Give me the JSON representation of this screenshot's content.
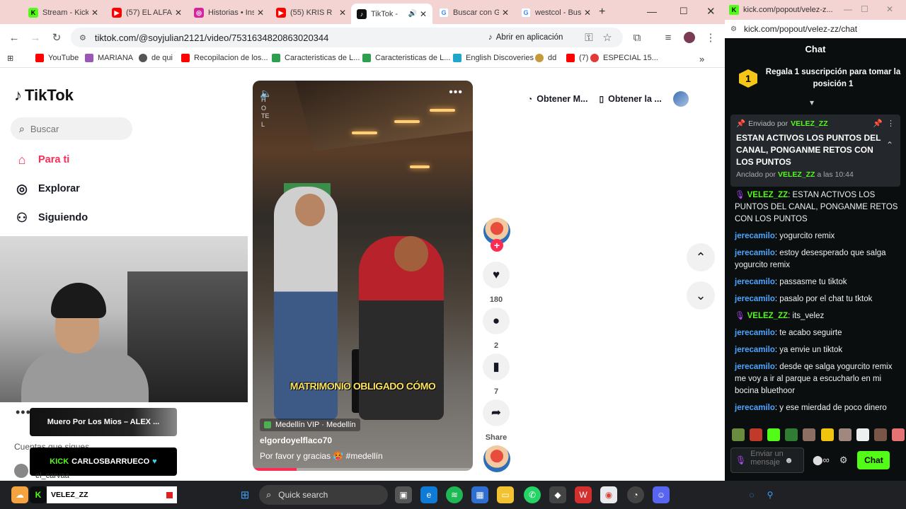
{
  "browser": {
    "tabs": [
      {
        "title": "Stream - Kick",
        "fav": "K",
        "fav_color": "#53fc18"
      },
      {
        "title": "(57) EL ALFA",
        "fav": "▶",
        "fav_color": "#ff0000"
      },
      {
        "title": "Historias • Instagram",
        "fav": "◎",
        "fav_color": "#d6249f"
      },
      {
        "title": "(55) KRIS R",
        "fav": "▶",
        "fav_color": "#ff0000"
      },
      {
        "title": "TikTok - ",
        "fav": "♪",
        "fav_color": "#111111"
      },
      {
        "title": "Buscar con Google",
        "fav": "G",
        "fav_color": "#4285f4"
      },
      {
        "title": "westcol - Buscar",
        "fav": "G",
        "fav_color": "#4285f4"
      }
    ],
    "url": "tiktok.com/@soyjulian2121/video/7531634820863020344",
    "open_in_app": "Abrir en aplicación",
    "bookmarks": [
      {
        "label": "YouTube",
        "color": "#ff0000"
      },
      {
        "label": "MARIANA",
        "color": "#9b59b6"
      },
      {
        "label": "de qui",
        "color": "#555555"
      },
      {
        "label": "Recopilacion de los...",
        "color": "#ff0000"
      },
      {
        "label": "Caracteristicas de L...",
        "color": "#2e9e4f"
      },
      {
        "label": "Caracteristicas de L...",
        "color": "#2e9e4f"
      },
      {
        "label": "English Discoveries",
        "color": "#1fa6c9"
      },
      {
        "label": "dd",
        "color": "#c49a3a"
      },
      {
        "label": "(7)",
        "color": "#ff0000"
      },
      {
        "label": "ESPECIAL 15...",
        "color": "#e03a3a"
      }
    ]
  },
  "tiktok": {
    "logo": "TikTok",
    "search_placeholder": "Buscar",
    "nav": [
      {
        "label": "Para ti",
        "icon": "home-icon"
      },
      {
        "label": "Explorar",
        "icon": "compass-icon"
      },
      {
        "label": "Siguiendo",
        "icon": "following-icon"
      }
    ],
    "top_right": {
      "get_app": "Obtener M...",
      "get_desktop": "Obtener la ..."
    },
    "following_label": "Cuentas que sigues",
    "follow_user": "el_carvaa",
    "video": {
      "caption_overlay": "MATRIMONIO OBLIGADO CÓMO",
      "location": "Medellín VIP · Medellín",
      "author": "elgordoyelflaco70",
      "description": "Por favor y gracias 🥵 #medellín",
      "progress": 0.2,
      "sign_text": "HOTEL"
    },
    "actions": [
      {
        "name": "like",
        "icon": "♥",
        "count": "180"
      },
      {
        "name": "comment",
        "icon": "●",
        "count": "2"
      },
      {
        "name": "save",
        "icon": "▮",
        "count": "7"
      },
      {
        "name": "share",
        "icon": "➦",
        "count": "Share"
      }
    ]
  },
  "overlays": {
    "song": "Muero Por Los Mios – ALEX ...",
    "sub_alert": "CARLOSBARRUECO",
    "sub_prefix": "KICK"
  },
  "kick": {
    "popup_tab": "kick.com/popout/velez-z...",
    "popup_url": "kick.com/popout/velez-zz/chat",
    "header": "Chat",
    "gift_rank": "1",
    "gift_text": "Regala 1 suscripción para tomar la posición 1",
    "pinned": {
      "sent_by": "Enviado por",
      "user": "VELEZ_ZZ",
      "message": "ESTAN ACTIVOS LOS PUNTOS DEL CANAL, PONGANME RETOS CON LOS PUNTOS",
      "pinned_by": "Anclado por",
      "pinned_at": "a las 10:44"
    },
    "messages": [
      {
        "user": "VELEZ_ZZ",
        "color": "green",
        "mic": true,
        "text": ": ESTAN ACTIVOS LOS PUNTOS DEL CANAL, PONGANME RETOS CON LOS PUNTOS"
      },
      {
        "user": "jerecamilo",
        "color": "blue",
        "mic": false,
        "text": ": yogurcito remix"
      },
      {
        "user": "jerecamilo",
        "color": "blue",
        "mic": false,
        "text": ": estoy desesperado que salga yogurcito remix"
      },
      {
        "user": "jerecamilo",
        "color": "blue",
        "mic": false,
        "text": ": passasme tu tiktok"
      },
      {
        "user": "jerecamilo",
        "color": "blue",
        "mic": false,
        "text": ": pasalo por el chat tu tktok"
      },
      {
        "user": "VELEZ_ZZ",
        "color": "green",
        "mic": true,
        "text": ": its_velez"
      },
      {
        "user": "jerecamilo",
        "color": "blue",
        "mic": false,
        "text": ": te acabo seguirte"
      },
      {
        "user": "jerecamilo",
        "color": "blue",
        "mic": false,
        "text": ": ya envie un tiktok"
      },
      {
        "user": "jerecamilo",
        "color": "blue",
        "mic": false,
        "text": ": desde qe salga yogurcito remix me voy a ir al parque a escucharlo en mi bocina bluethoor"
      },
      {
        "user": "jerecamilo",
        "color": "blue",
        "mic": false,
        "text": ": y ese mierdad de poco dinero"
      }
    ],
    "input_placeholder": "Enviar un mensaje",
    "send_label": "Chat"
  },
  "taskbar": {
    "stream_label": "VELEZ_ZZ",
    "search_placeholder": "Quick search"
  }
}
